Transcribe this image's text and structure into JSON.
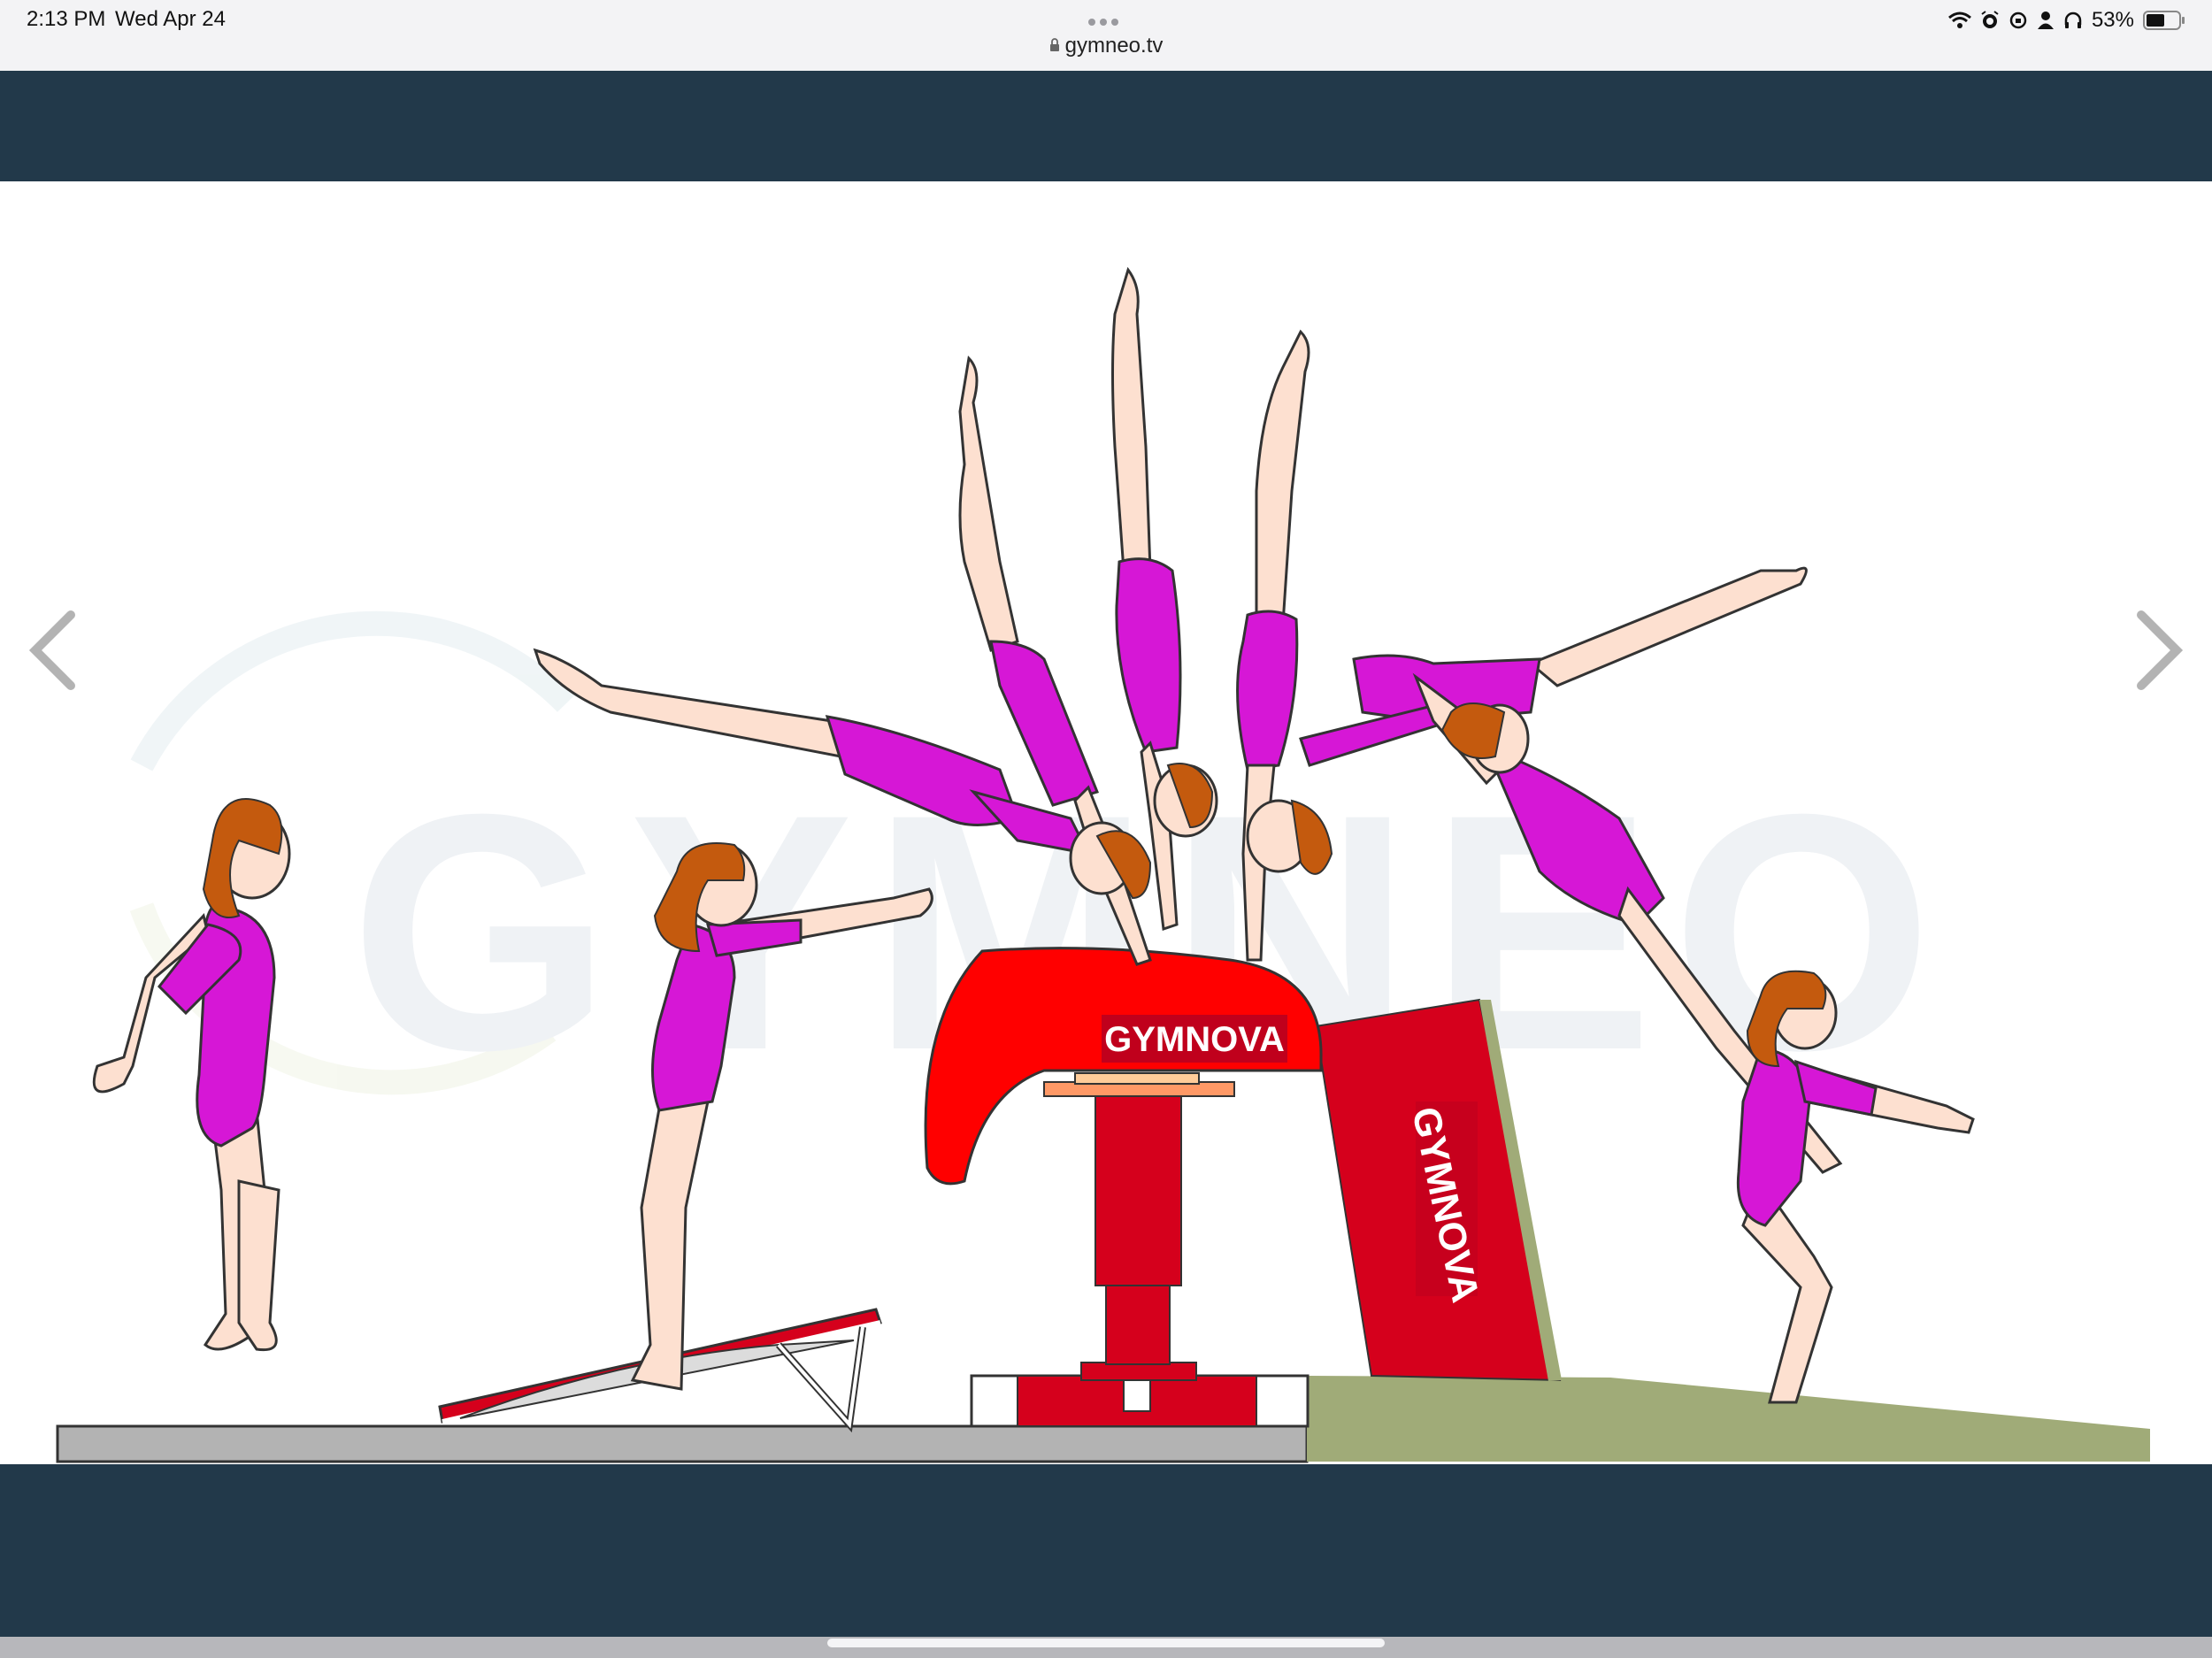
{
  "status_bar": {
    "time": "2:13 PM",
    "date": "Wed Apr 24",
    "url": "gymneo.tv",
    "battery_percent": "53%",
    "icons": [
      "wifi-icon",
      "alarm-icon",
      "rotation-lock-icon",
      "person-icon",
      "headphones-icon",
      "battery-icon"
    ]
  },
  "illustration": {
    "watermark": "GYMNEO",
    "brand_vault": "GYMNOVA",
    "brand_mat": "GYMNOVA"
  },
  "colors": {
    "nav_bar": "#22394a",
    "leotard": "#d617d6",
    "vault_red": "#ff0000",
    "mat_green": "#a0ab78"
  }
}
